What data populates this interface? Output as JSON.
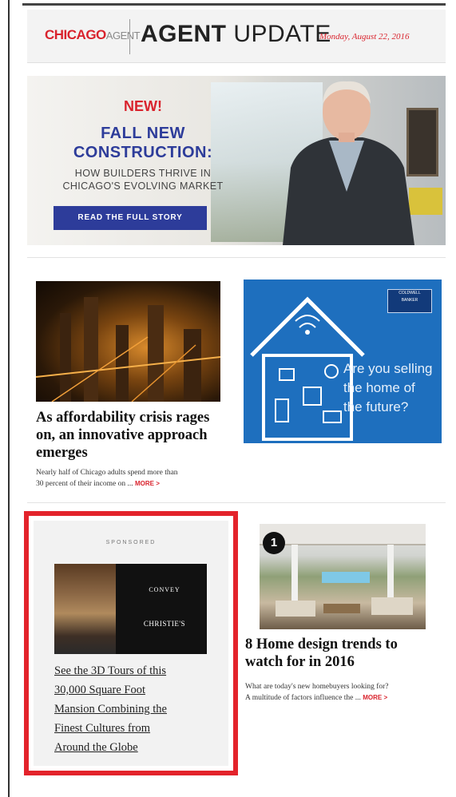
{
  "header": {
    "logo_main": "CHICAGO",
    "logo_sub": "AGENT",
    "title_bold": "AGENT",
    "title_light": "UPDATE",
    "date": "Monday, August 22, 2016"
  },
  "hero": {
    "new_label": "NEW!",
    "headline_line1": "FALL NEW",
    "headline_line2": "CONSTRUCTION:",
    "sub_line1": "HOW BUILDERS THRIVE IN",
    "sub_line2": "CHICAGO'S EVOLVING MARKET",
    "button_label": "READ THE FULL STORY"
  },
  "story1": {
    "headline_line1": "As affordability crisis rages",
    "headline_line2": "on, an innovative approach",
    "headline_line3": "emerges",
    "teaser_line1": "Nearly half of Chicago adults spend more than",
    "teaser_line2": "30 percent of their income on ...",
    "more_label": "MORE >"
  },
  "ad": {
    "badge_line1": "COLDWELL",
    "badge_line2": "BANKER",
    "text_line1": "Are you selling",
    "text_line2": "the home of",
    "text_line3": "the future?"
  },
  "sponsored": {
    "label": "SPONSORED",
    "logo1": "CONVEY",
    "logo2": "CHRISTIE'S",
    "link_line1": "See the 3D Tours of this",
    "link_line2": "30,000 Square Foot",
    "link_line3": "Mansion Combining the",
    "link_line4": "Finest Cultures from",
    "link_line5": "Around the Globe"
  },
  "story2": {
    "rank": "1",
    "headline_line1": "8 Home design trends to",
    "headline_line2": "watch for in 2016",
    "teaser_line1": "What are today's new homebuyers looking for?",
    "teaser_line2": "A multitude of factors influence the ...",
    "more_label": "MORE >"
  },
  "colors": {
    "brand_red": "#d9232d",
    "brand_blue": "#2d3c9a",
    "highlight_red": "#e3232b",
    "ad_blue": "#1e6fbe"
  }
}
